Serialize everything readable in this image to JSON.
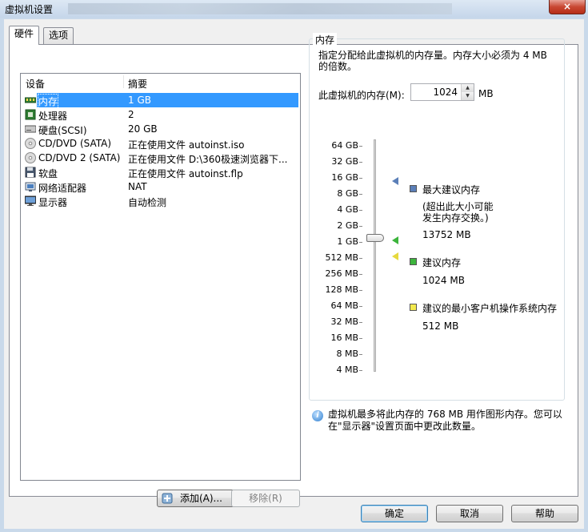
{
  "window": {
    "title": "虚拟机设置",
    "close_glyph": "×"
  },
  "tabs": [
    {
      "label": "硬件",
      "active": true
    },
    {
      "label": "选项",
      "active": false
    }
  ],
  "device_list": {
    "columns": [
      "设备",
      "摘要"
    ],
    "rows": [
      {
        "icon": "memory-icon",
        "name": "内存",
        "summary": "1 GB",
        "selected": true
      },
      {
        "icon": "processor-icon",
        "name": "处理器",
        "summary": "2",
        "selected": false
      },
      {
        "icon": "hard-disk-icon",
        "name": "硬盘(SCSI)",
        "summary": "20 GB",
        "selected": false
      },
      {
        "icon": "cd-dvd-icon",
        "name": "CD/DVD (SATA)",
        "summary": "正在使用文件 autoinst.iso",
        "selected": false
      },
      {
        "icon": "cd-dvd-icon",
        "name": "CD/DVD 2 (SATA)",
        "summary": "正在使用文件 D:\\360极速浏览器下...",
        "selected": false
      },
      {
        "icon": "floppy-icon",
        "name": "软盘",
        "summary": "正在使用文件 autoinst.flp",
        "selected": false
      },
      {
        "icon": "network-adapter-icon",
        "name": "网络适配器",
        "summary": "NAT",
        "selected": false
      },
      {
        "icon": "display-icon",
        "name": "显示器",
        "summary": "自动检测",
        "selected": false
      }
    ]
  },
  "list_buttons": {
    "add": "添加(A)...",
    "remove": "移除(R)"
  },
  "memory": {
    "group_title": "内存",
    "description": "指定分配给此虚拟机的内存量。内存大小必须为 4 MB 的倍数。",
    "field_label": "此虚拟机的内存(M):",
    "value": "1024",
    "unit": "MB",
    "scale": [
      "64 GB",
      "32 GB",
      "16 GB",
      "8 GB",
      "4 GB",
      "2 GB",
      "1 GB",
      "512 MB",
      "256 MB",
      "128 MB",
      "64 MB",
      "32 MB",
      "16 MB",
      "8 MB",
      "4 MB"
    ],
    "slider_value": "1 GB",
    "legend": {
      "max": {
        "title": "最大建议内存",
        "note": "(超出此大小可能发生内存交换。)",
        "value": "13752 MB",
        "color": "#5b7fb8"
      },
      "recommended": {
        "title": "建议内存",
        "value": "1024 MB",
        "color": "#3cb43c"
      },
      "min": {
        "title": "建议的最小客户机操作系统内存",
        "value": "512 MB",
        "color": "#f2e94e"
      }
    },
    "info": "虚拟机最多将此内存的 768 MB 用作图形内存。您可以在\"显示器\"设置页面中更改此数量。"
  },
  "dialog_buttons": {
    "ok": "确定",
    "cancel": "取消",
    "help": "帮助"
  }
}
